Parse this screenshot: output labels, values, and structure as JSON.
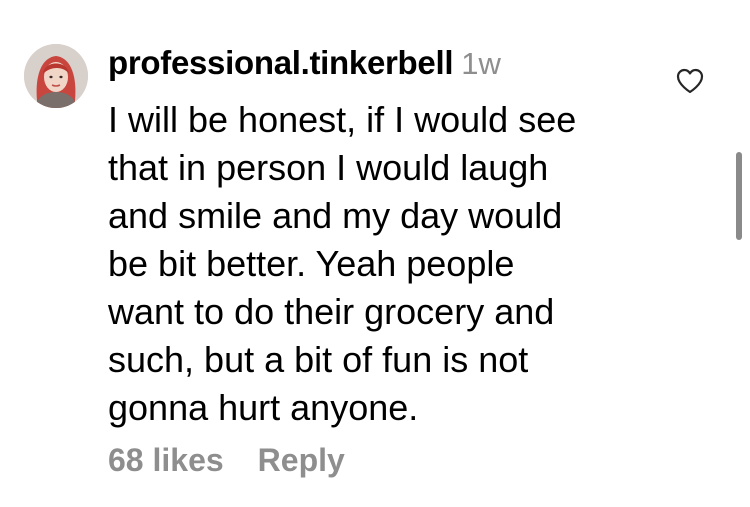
{
  "comment": {
    "username": "professional.tinkerbell",
    "timestamp": "1w",
    "lines": [
      "I will be honest, if I would see",
      "that in person I would laugh",
      "and smile and my day would",
      "be bit better. Yeah people",
      "want to do their grocery and",
      "such, but a bit of fun is not",
      "gonna hurt anyone."
    ],
    "likes_label": "68 likes",
    "reply_label": "Reply"
  },
  "icons": {
    "avatar": "user-avatar",
    "like": "heart-outline-icon"
  },
  "colors": {
    "text": "#000000",
    "secondary": "#8e8e8e",
    "hair": "#c9463f",
    "background": "#ffffff"
  }
}
